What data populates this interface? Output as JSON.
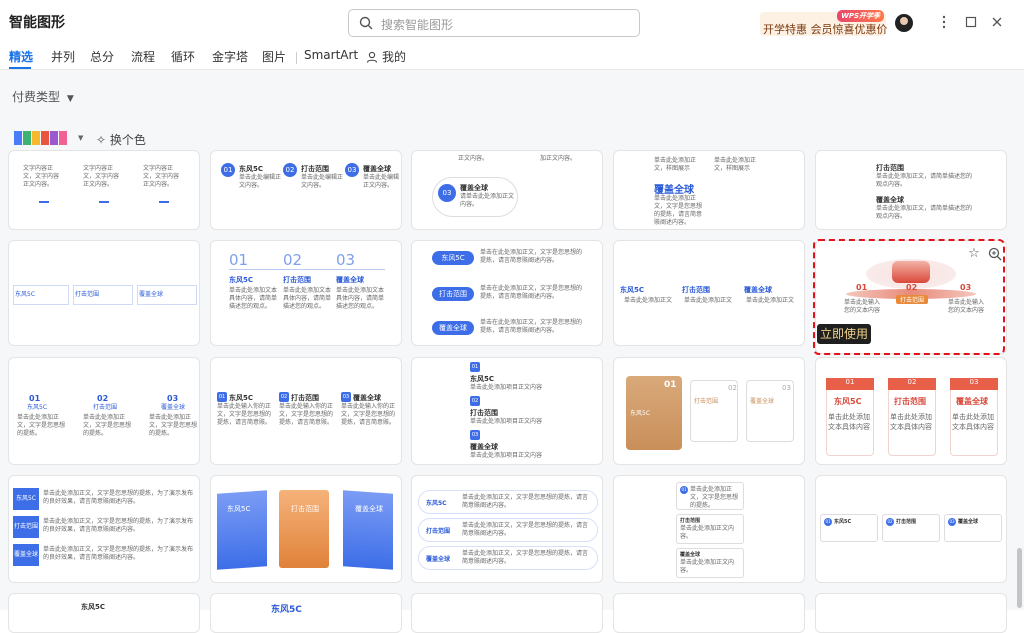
{
  "titlebar": {
    "app_title": "智能图形",
    "search_placeholder": "搜索智能图形",
    "promo_badge": "WPS开学季",
    "promo_text": "开学特惠 会员惊喜优惠价"
  },
  "tabs": [
    {
      "label": "精选",
      "active": true
    },
    {
      "label": "并列"
    },
    {
      "label": "总分"
    },
    {
      "label": "流程"
    },
    {
      "label": "循环"
    },
    {
      "label": "金字塔"
    },
    {
      "label": "图片"
    },
    {
      "label": "SmartArt"
    },
    {
      "label": "我的"
    }
  ],
  "filter": {
    "label": "付费类型"
  },
  "color": {
    "swatches": [
      "#4a7cf7",
      "#3cb371",
      "#f5b82e",
      "#e8563f",
      "#9b59d0",
      "#f06292"
    ],
    "swap_label": "换个色"
  },
  "cards": {
    "row1": {
      "c2": {
        "a": "东风5C",
        "b": "打击范围",
        "c": "覆盖全球",
        "desc": "单击此处编辑正文内容。"
      },
      "c3": {
        "t1": "正文内容。",
        "t2": "加正文内容。",
        "n": "03",
        "title": "覆盖全球",
        "desc": "请单击此处添加正文内容。"
      },
      "c4": {
        "title": "覆盖全球"
      },
      "c5": {
        "a": "打击范围",
        "b": "覆盖全球"
      }
    },
    "row2": {
      "c2": {
        "n1": "01",
        "n2": "02",
        "n3": "03",
        "a": "东风5C",
        "b": "打击范围",
        "c": "覆盖全球",
        "desc": "单击此处添加文本具体内容，请简单描述您的观点。"
      },
      "c3": {
        "a": "东风5C",
        "b": "打击范围",
        "c": "覆盖全球",
        "desc": "单击在此处添加正文，文字是您思想的提炼，请言简意赅阐述内容。"
      },
      "c4": {
        "a": "东风5C",
        "b": "打击范围",
        "c": "覆盖全球",
        "desc": "单击此处添加正文"
      },
      "c5": {
        "n1": "01",
        "n2": "02",
        "n3": "03",
        "mid": "打击范围",
        "use_label": "立即使用"
      }
    },
    "row3": {
      "c1": {
        "n1": "01",
        "n2": "02",
        "n3": "03",
        "a": "东风5C",
        "b": "打击范围",
        "c": "覆盖全球"
      },
      "c2": {
        "a": "东风5C",
        "b": "打击范围",
        "c": "覆盖全球"
      },
      "c3": {
        "n1": "01",
        "n2": "02",
        "n3": "03",
        "a": "东风5C",
        "b": "打击范围",
        "c": "覆盖全球",
        "desc": "单击此处添加项目正文内容"
      },
      "c4": {
        "n1": "01",
        "n2": "02",
        "n3": "03",
        "a": "东风5C",
        "b": "打击范围",
        "c": "覆盖全球"
      },
      "c5": {
        "n1": "01",
        "n2": "02",
        "n3": "03",
        "a": "东风5C",
        "b": "打击范围",
        "c": "覆盖全球",
        "desc": "单击此处添加文本具体内容"
      }
    },
    "row4": {
      "c1": {
        "a": "东风5C",
        "b": "打击范围",
        "c": "覆盖全球"
      },
      "c2": {
        "a": "东风5C",
        "b": "打击范围",
        "c": "覆盖全球"
      },
      "c3": {
        "a": "东风5C",
        "b": "打击范围",
        "c": "覆盖全球"
      },
      "c4": {
        "a": "东风5C",
        "b": "打击范围",
        "c": "覆盖全球"
      },
      "c5": {
        "a": "东风5C",
        "b": "打击范围",
        "c": "覆盖全球"
      }
    },
    "row5": {
      "c2": "东风5C",
      "c3": "东风5C"
    }
  }
}
